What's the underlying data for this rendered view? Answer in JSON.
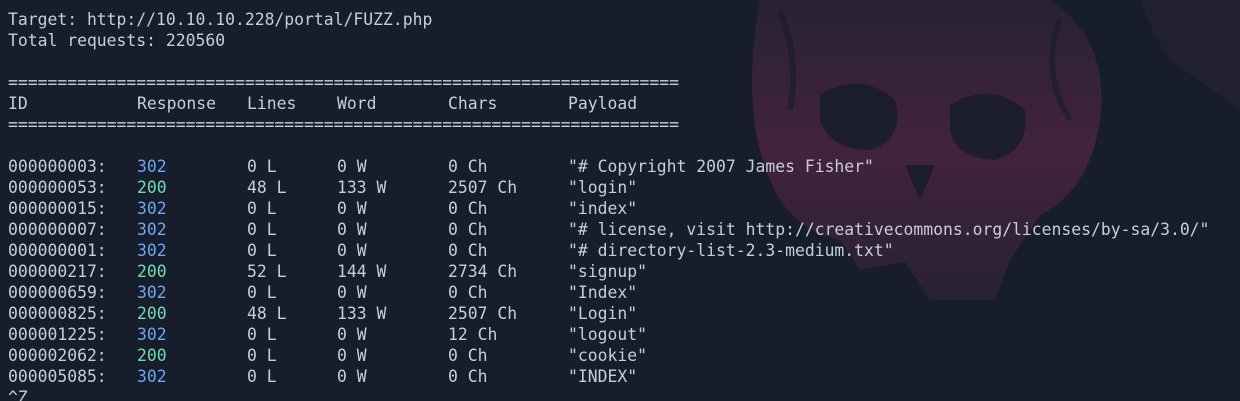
{
  "header": {
    "target": "Target: http://10.10.10.228/portal/FUZZ.php",
    "total": "Total requests: 220560"
  },
  "separator": "====================================================================",
  "columns": {
    "id": "ID",
    "response": "Response",
    "lines": "Lines",
    "word": "Word",
    "chars": "Chars",
    "payload": "Payload"
  },
  "rows": [
    {
      "id": "000000003:",
      "response": "302",
      "lines": "0 L",
      "word": "0 W",
      "chars": "0 Ch",
      "payload": "\"# Copyright 2007 James Fisher\""
    },
    {
      "id": "000000053:",
      "response": "200",
      "lines": "48 L",
      "word": "133 W",
      "chars": "2507 Ch",
      "payload": "\"login\""
    },
    {
      "id": "000000015:",
      "response": "302",
      "lines": "0 L",
      "word": "0 W",
      "chars": "0 Ch",
      "payload": "\"index\""
    },
    {
      "id": "000000007:",
      "response": "302",
      "lines": "0 L",
      "word": "0 W",
      "chars": "0 Ch",
      "payload": "\"# license, visit http://creativecommons.org/licenses/by-sa/3.0/\""
    },
    {
      "id": "000000001:",
      "response": "302",
      "lines": "0 L",
      "word": "0 W",
      "chars": "0 Ch",
      "payload": "\"# directory-list-2.3-medium.txt\""
    },
    {
      "id": "000000217:",
      "response": "200",
      "lines": "52 L",
      "word": "144 W",
      "chars": "2734 Ch",
      "payload": "\"signup\""
    },
    {
      "id": "000000659:",
      "response": "302",
      "lines": "0 L",
      "word": "0 W",
      "chars": "0 Ch",
      "payload": "\"Index\""
    },
    {
      "id": "000000825:",
      "response": "200",
      "lines": "48 L",
      "word": "133 W",
      "chars": "2507 Ch",
      "payload": "\"Login\""
    },
    {
      "id": "000001225:",
      "response": "302",
      "lines": "0 L",
      "word": "0 W",
      "chars": "12 Ch",
      "payload": "\"logout\""
    },
    {
      "id": "000002062:",
      "response": "200",
      "lines": "0 L",
      "word": "0 W",
      "chars": "0 Ch",
      "payload": "\"cookie\""
    },
    {
      "id": "000005085:",
      "response": "302",
      "lines": "0 L",
      "word": "0 W",
      "chars": "0 Ch",
      "payload": "\"INDEX\""
    }
  ],
  "prompt": "^Z",
  "colors": {
    "background": "#181d2b",
    "text": "#c9cdd6",
    "code_302": "#6aa8f0",
    "code_200": "#6fdcb2",
    "wallpaper_accent": "#4a2440"
  }
}
